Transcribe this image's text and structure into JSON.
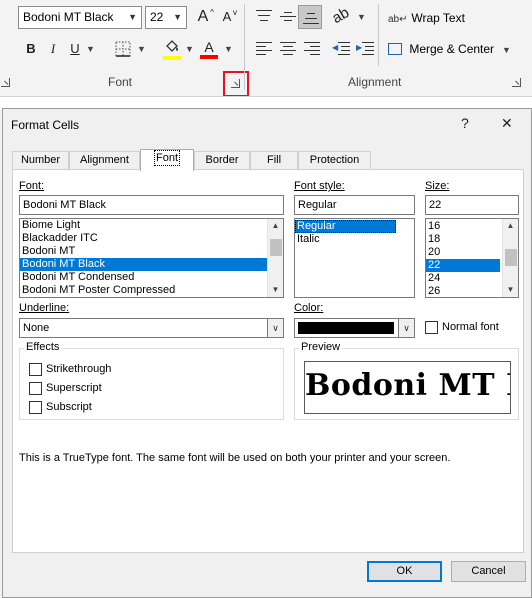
{
  "ribbon": {
    "font_name": "Bodoni MT Black",
    "font_size": "22",
    "grow_font": "A",
    "shrink_font": "A",
    "bold": "B",
    "italic": "I",
    "underline": "U",
    "font_color_letter": "A",
    "wrap_text": "Wrap Text",
    "merge_center": "Merge & Center",
    "group_font": "Font",
    "group_alignment": "Alignment",
    "colors": {
      "highlight": "#ffff00",
      "font_color": "#ff0000",
      "focus_box": "#e81123"
    }
  },
  "dialog": {
    "title": "Format Cells",
    "help": "?",
    "close": "✕",
    "tabs": [
      "Number",
      "Alignment",
      "Font",
      "Border",
      "Fill",
      "Protection"
    ],
    "active_tab": "Font",
    "font_label": "Font:",
    "font_value": "Bodoni MT Black",
    "font_list": [
      "Biome Light",
      "Blackadder ITC",
      "Bodoni MT",
      "Bodoni MT Black",
      "Bodoni MT Condensed",
      "Bodoni MT Poster Compressed"
    ],
    "style_label": "Font style:",
    "style_value": "Regular",
    "style_list": [
      "Regular",
      "Italic"
    ],
    "size_label": "Size:",
    "size_value": "22",
    "size_list": [
      "16",
      "18",
      "20",
      "22",
      "24",
      "26"
    ],
    "underline_label": "Underline:",
    "underline_value": "None",
    "color_label": "Color:",
    "color_value": "#000000",
    "normal_font": "Normal font",
    "effects_title": "Effects",
    "strikethrough": "Strikethrough",
    "superscript": "Superscript",
    "subscript": "Subscript",
    "preview_title": "Preview",
    "preview_text": "Bodoni MT Bl",
    "info": "This is a TrueType font.  The same font will be used on both your printer and your screen.",
    "ok": "OK",
    "cancel": "Cancel",
    "accent": "#0078d7"
  }
}
